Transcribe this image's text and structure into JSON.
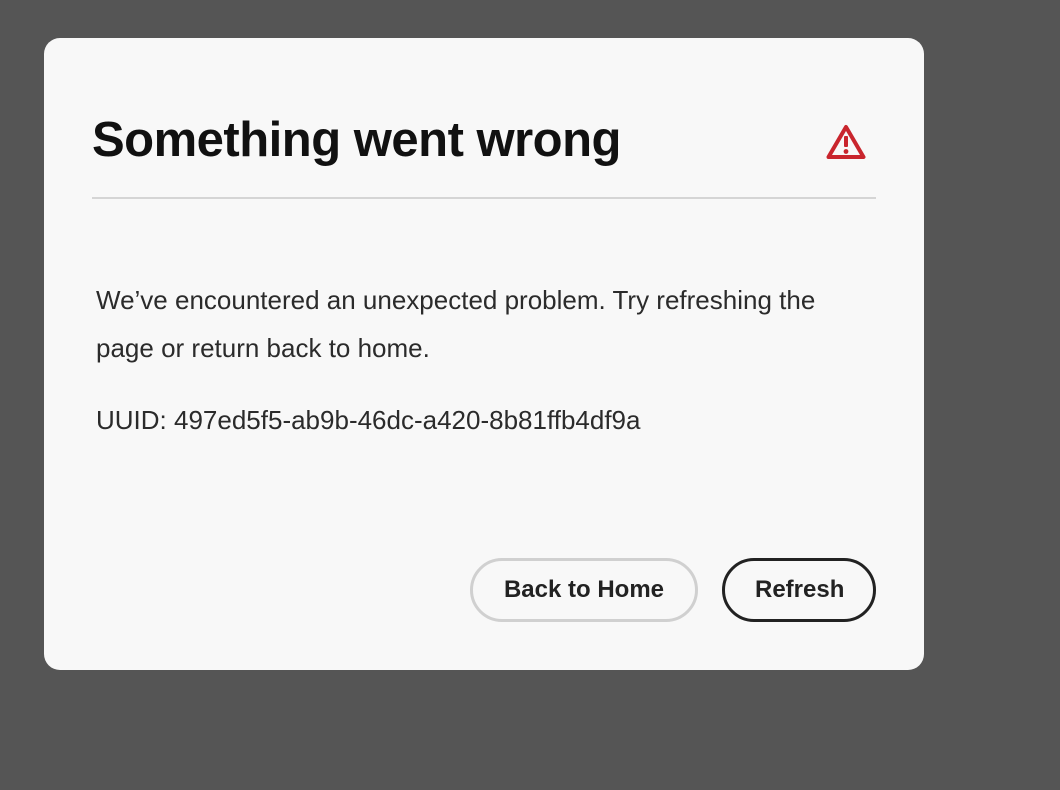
{
  "dialog": {
    "title": "Something went wrong",
    "icon": "alert-triangle-icon",
    "message": "We’ve encountered an unexpected problem. Try refreshing the page or return back to home.",
    "uuid_text": "UUID: 497ed5f5-ab9b-46dc-a420-8b81ffb4df9a",
    "buttons": {
      "back_home_label": "Back to Home",
      "refresh_label": "Refresh"
    }
  },
  "colors": {
    "overlay": "#555555",
    "dialog_bg": "#f8f8f8",
    "alert_red": "#c9252d",
    "text": "#2b2b2b",
    "title": "#111111"
  }
}
